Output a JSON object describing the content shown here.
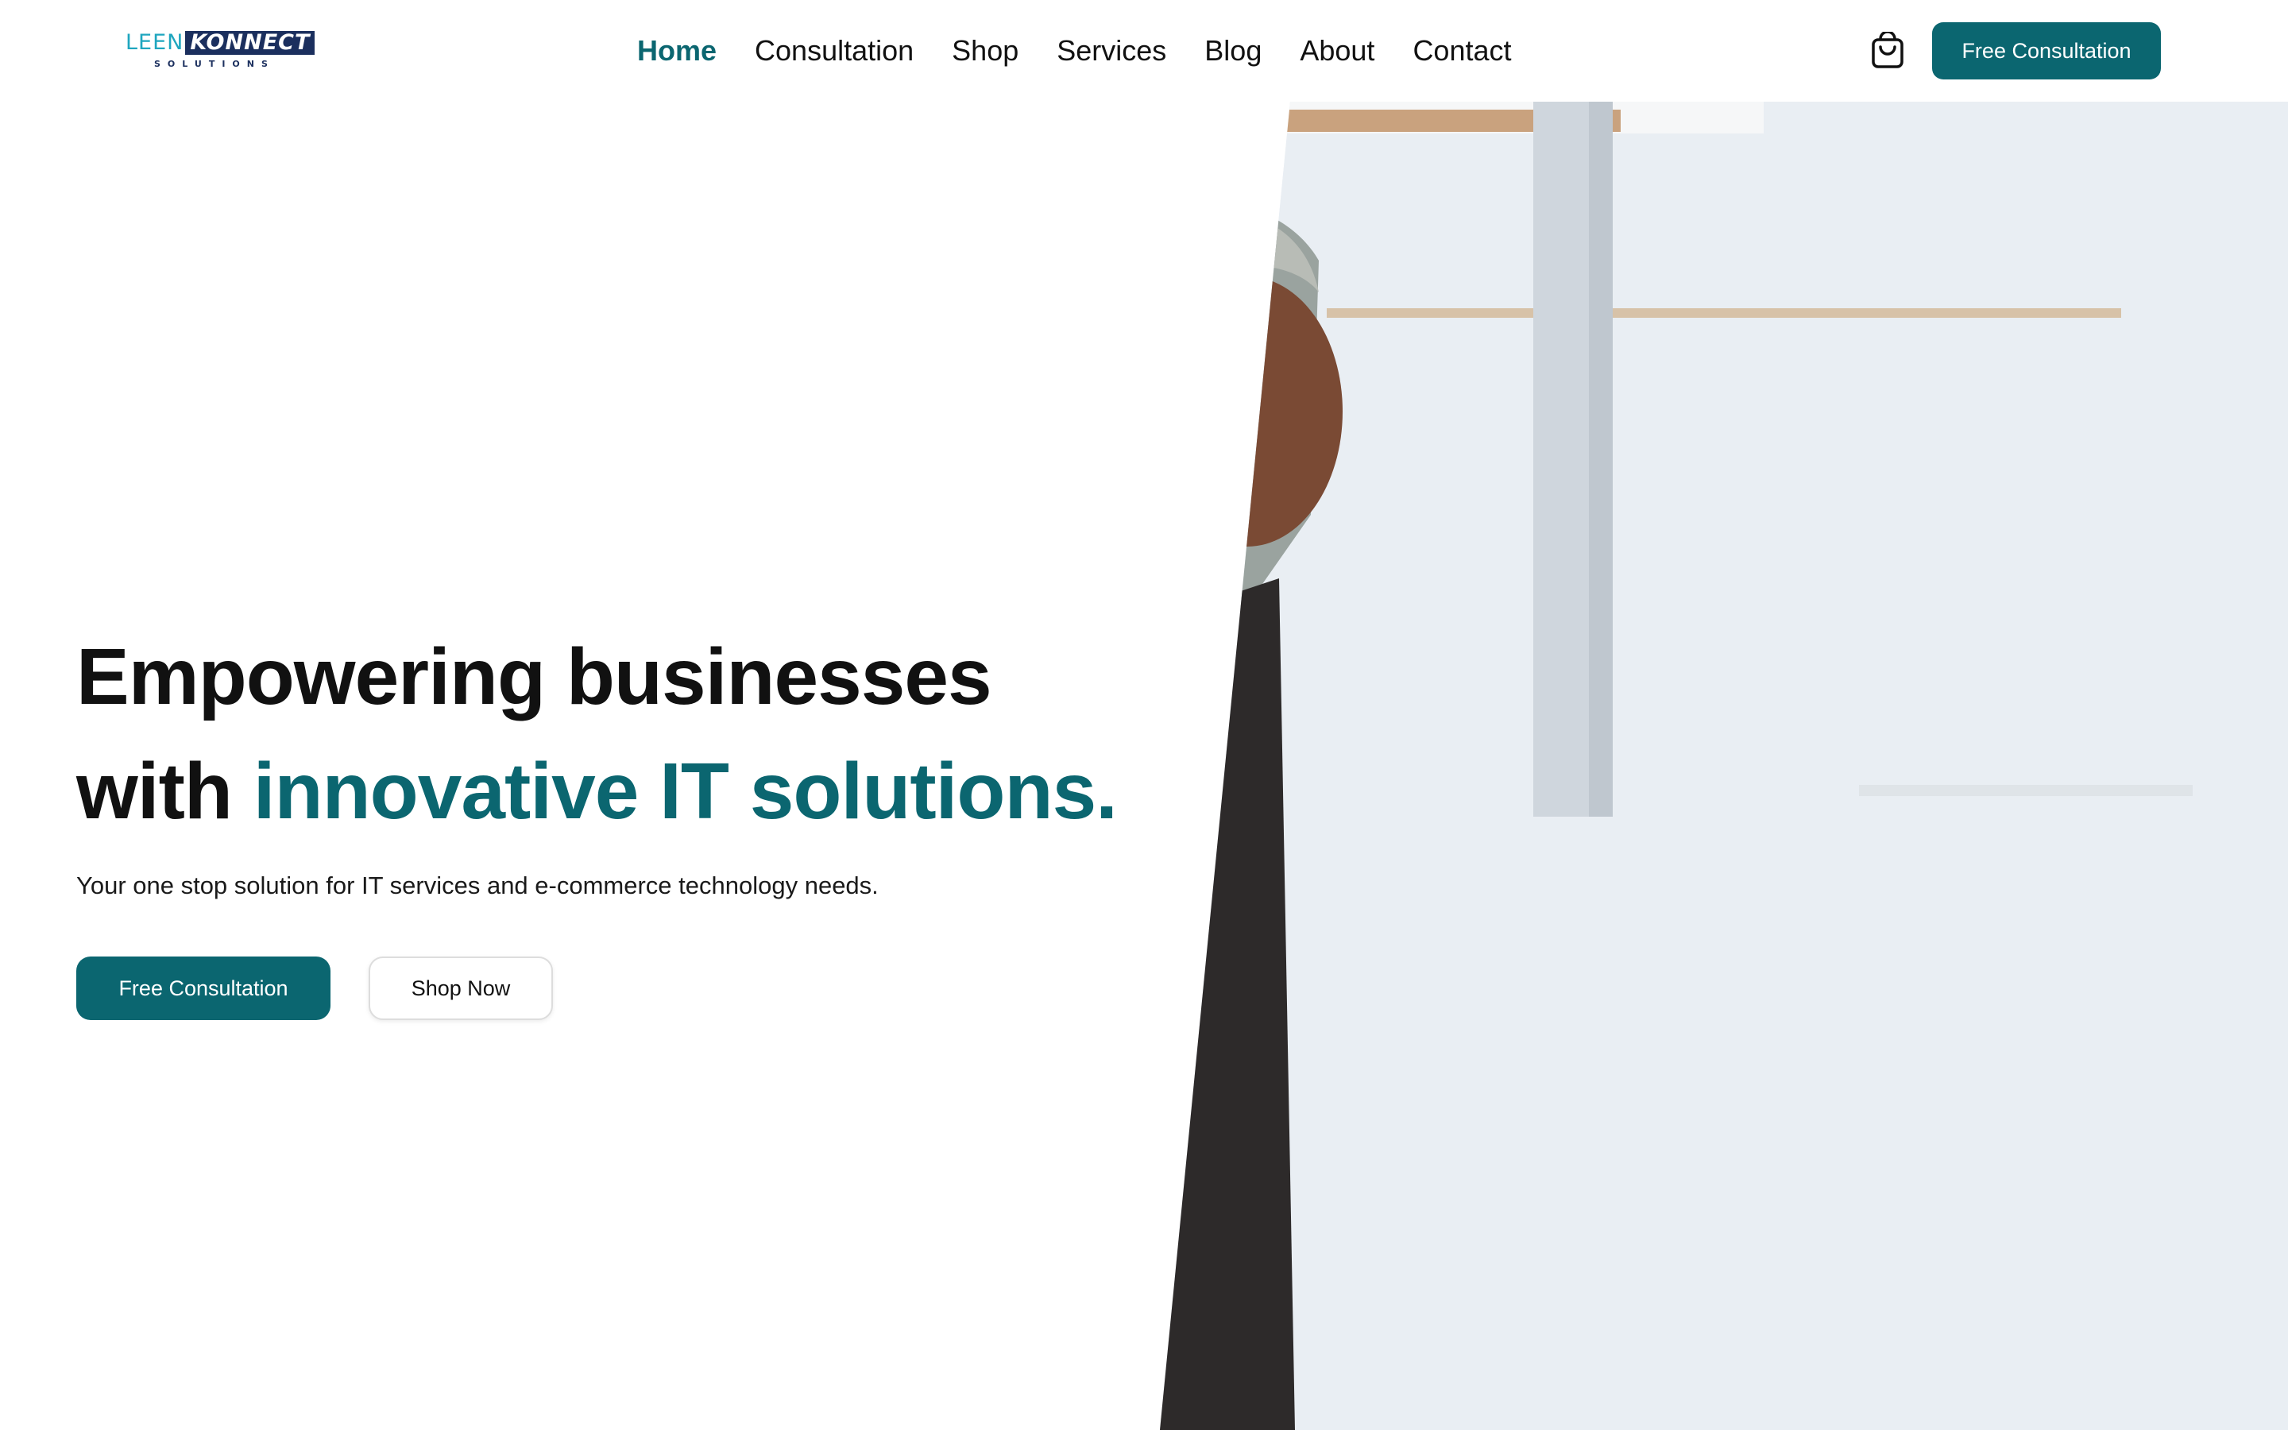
{
  "header": {
    "logo": {
      "primary": "LEEN",
      "secondary": "KONNECT",
      "tagline": "SOLUTIONS"
    },
    "nav": [
      {
        "label": "Home",
        "active": true
      },
      {
        "label": "Consultation",
        "active": false
      },
      {
        "label": "Shop",
        "active": false
      },
      {
        "label": "Services",
        "active": false
      },
      {
        "label": "Blog",
        "active": false
      },
      {
        "label": "About",
        "active": false
      },
      {
        "label": "Contact",
        "active": false
      }
    ],
    "cart_icon": "shopping-bag-icon",
    "cta_label": "Free Consultation"
  },
  "hero": {
    "headline_line1": "Empowering businesses",
    "headline_line2_prefix": "with ",
    "headline_line2_accent": "innovative IT solutions.",
    "subline": "Your one stop solution for IT services and e-commerce technology needs.",
    "primary_button": "Free Consultation",
    "secondary_button": "Shop Now"
  },
  "colors": {
    "brand": "#0b6670",
    "text": "#111111",
    "background": "#ffffff",
    "logo_navy": "#1b2f5e",
    "logo_cyan": "#1fa6bf"
  }
}
